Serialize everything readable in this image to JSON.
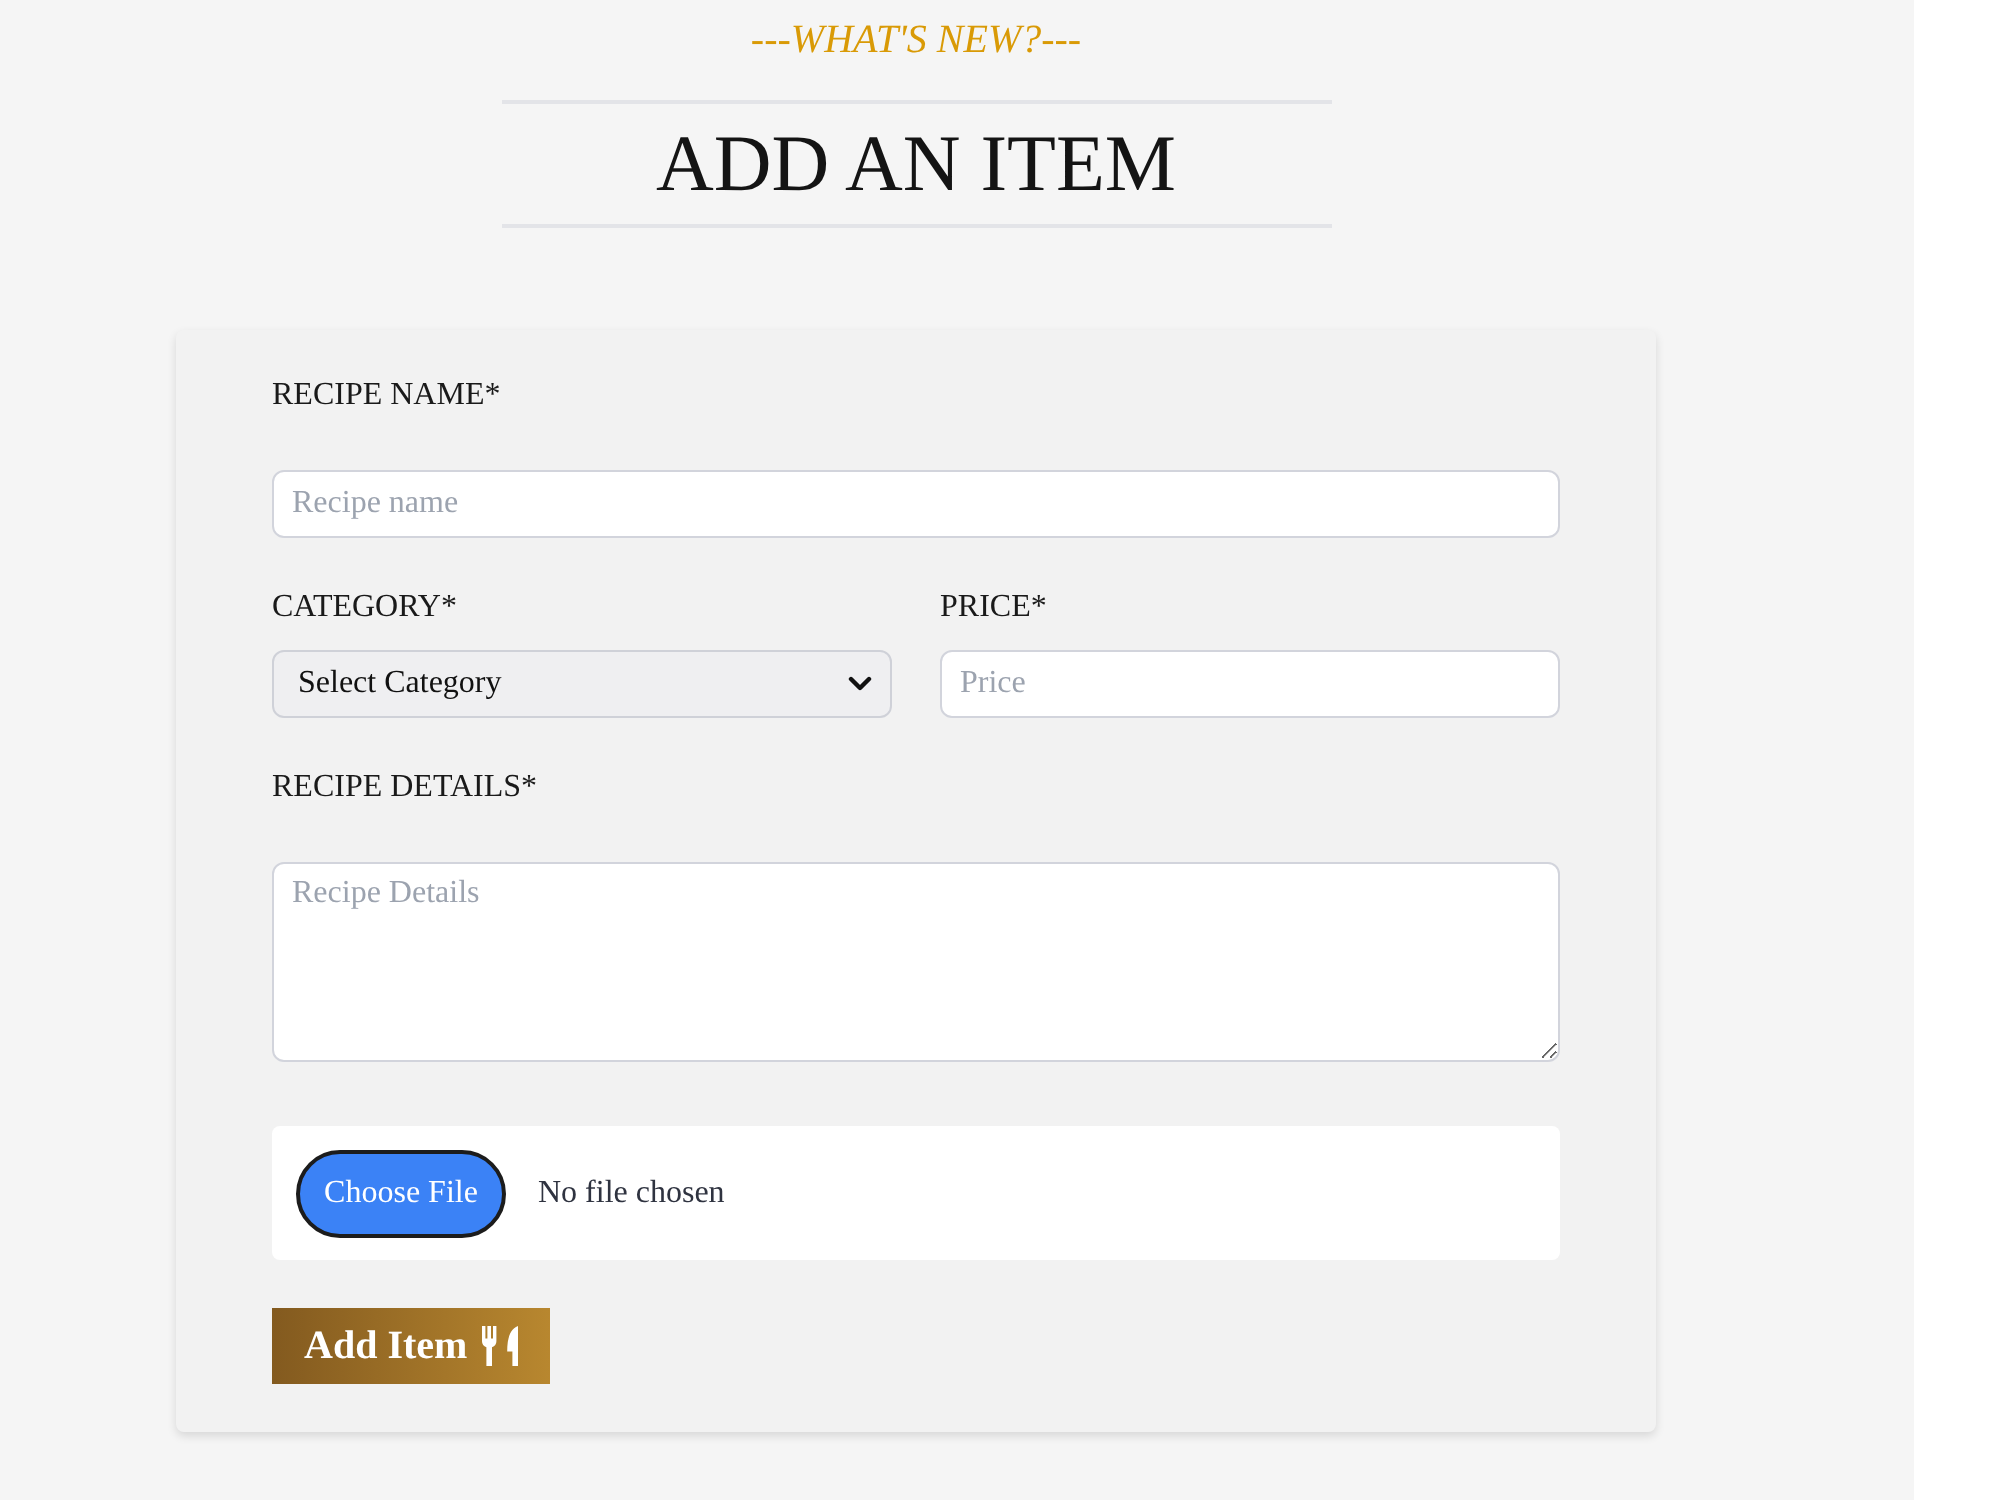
{
  "header": {
    "subtitle": "---WHAT'S NEW?---",
    "title": "ADD AN ITEM"
  },
  "form": {
    "rows": [
      {
        "fields": [
          {
            "kind": "text",
            "label": "RECIPE NAME*",
            "placeholder": "Recipe name"
          }
        ]
      },
      {
        "fields": [
          {
            "kind": "select",
            "label": "CATEGORY*",
            "value": "Select Category"
          },
          {
            "kind": "text",
            "label": "PRICE*",
            "placeholder": "Price"
          }
        ]
      },
      {
        "fields": [
          {
            "kind": "textarea",
            "label": "RECIPE DETAILS*",
            "placeholder": "Recipe Details"
          }
        ]
      }
    ],
    "file_input": {
      "button": "Choose File",
      "status": "No file chosen"
    },
    "submit_button": {
      "label": "Add Item"
    }
  }
}
